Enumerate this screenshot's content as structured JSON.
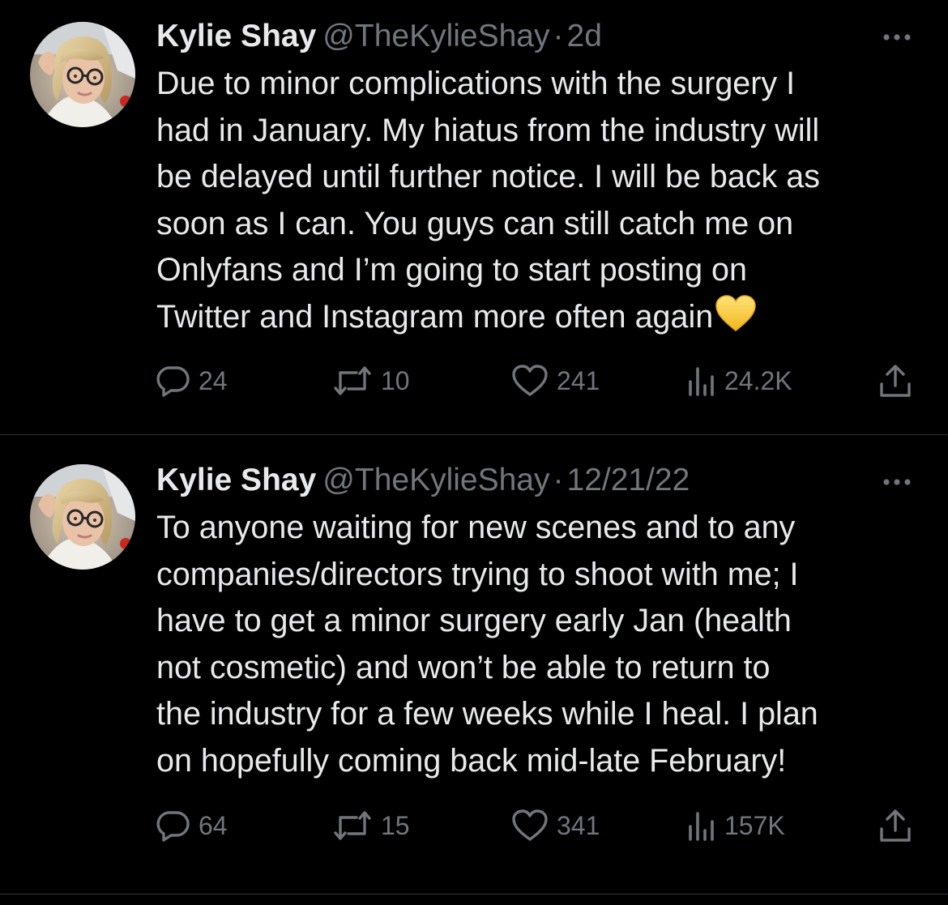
{
  "tweets": [
    {
      "author": {
        "name": "Kylie Shay",
        "handle": "@TheKylieShay"
      },
      "separator": "·",
      "time": "2d",
      "text_lines": [
        "Due to minor complications with the surgery I",
        "had in January. My hiatus from the industry will",
        "be delayed until further notice. I will be back as",
        "soon as I can. You guys can still catch me on",
        "Onlyfans and I’m going to start posting on",
        "Twitter and Instagram more often again"
      ],
      "emoji": "yellow-heart",
      "stats": {
        "replies": "24",
        "retweets": "10",
        "likes": "241",
        "views": "24.2K"
      }
    },
    {
      "author": {
        "name": "Kylie Shay",
        "handle": "@TheKylieShay"
      },
      "separator": "·",
      "time": "12/21/22",
      "text_lines": [
        "To anyone waiting for new scenes and to any",
        "companies/directors trying to shoot with me; I",
        "have to get a minor surgery early Jan (health",
        "not cosmetic) and won’t be able to return to",
        "the industry for a few weeks while I heal. I plan",
        "on hopefully coming back mid-late February!"
      ],
      "stats": {
        "replies": "64",
        "retweets": "15",
        "likes": "341",
        "views": "157K"
      }
    }
  ],
  "icons": {
    "more": "more-horizontal-icon",
    "reply": "reply-icon",
    "retweet": "retweet-icon",
    "like": "heart-icon",
    "views": "views-icon",
    "share": "share-icon"
  },
  "colors": {
    "background": "#000000",
    "primary_text": "#e7e9ea",
    "secondary_text": "#71767b",
    "divider": "#2f3336",
    "emoji_heart": "#f5c518"
  }
}
